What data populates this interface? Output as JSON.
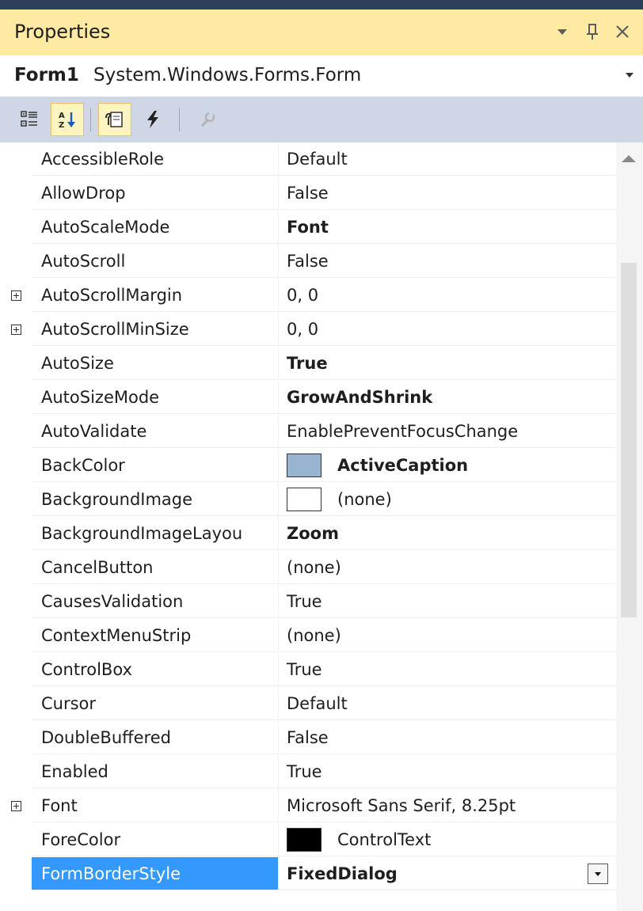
{
  "panel": {
    "title": "Properties",
    "pin_glyph": "1",
    "dropdown_glyph": "▾",
    "close_glyph": "✕"
  },
  "object_selector": {
    "name": "Form1",
    "type": "System.Windows.Forms.Form",
    "dropdown_glyph": "▾"
  },
  "toolbar": {
    "buttons": [
      "categorized-icon",
      "alphabetical-icon",
      "properties-icon",
      "events-icon",
      "property-pages-icon"
    ],
    "active": [
      "alphabetical-icon",
      "properties-icon"
    ]
  },
  "properties": [
    {
      "name": "AccessibleRole",
      "value": "Default"
    },
    {
      "name": "AllowDrop",
      "value": "False"
    },
    {
      "name": "AutoScaleMode",
      "value": "Font",
      "bold": true
    },
    {
      "name": "AutoScroll",
      "value": "False"
    },
    {
      "name": "AutoScrollMargin",
      "value": "0, 0",
      "expandable": true
    },
    {
      "name": "AutoScrollMinSize",
      "value": "0, 0",
      "expandable": true
    },
    {
      "name": "AutoSize",
      "value": "True",
      "bold": true
    },
    {
      "name": "AutoSizeMode",
      "value": "GrowAndShrink",
      "bold": true
    },
    {
      "name": "AutoValidate",
      "value": "EnablePreventFocusChange"
    },
    {
      "name": "BackColor",
      "value": "ActiveCaption",
      "bold": true,
      "swatch": "#99b4d1"
    },
    {
      "name": "BackgroundImage",
      "value": "(none)",
      "swatch": "#ffffff"
    },
    {
      "name": "BackgroundImageLayou",
      "value": "Zoom",
      "bold": true
    },
    {
      "name": "CancelButton",
      "value": "(none)"
    },
    {
      "name": "CausesValidation",
      "value": "True"
    },
    {
      "name": "ContextMenuStrip",
      "value": "(none)"
    },
    {
      "name": "ControlBox",
      "value": "True"
    },
    {
      "name": "Cursor",
      "value": "Default"
    },
    {
      "name": "DoubleBuffered",
      "value": "False"
    },
    {
      "name": "Enabled",
      "value": "True"
    },
    {
      "name": "Font",
      "value": "Microsoft Sans Serif, 8.25pt",
      "expandable": true
    },
    {
      "name": "ForeColor",
      "value": "ControlText",
      "swatch": "#000000"
    },
    {
      "name": "FormBorderStyle",
      "value": "FixedDialog",
      "bold": true,
      "selected": true,
      "combo": true
    }
  ],
  "colors": {
    "title_bar": "#ffeaa3",
    "toolbar": "#cfd6e5",
    "selection": "#3399ff",
    "top_strip": "#2d3e58"
  }
}
